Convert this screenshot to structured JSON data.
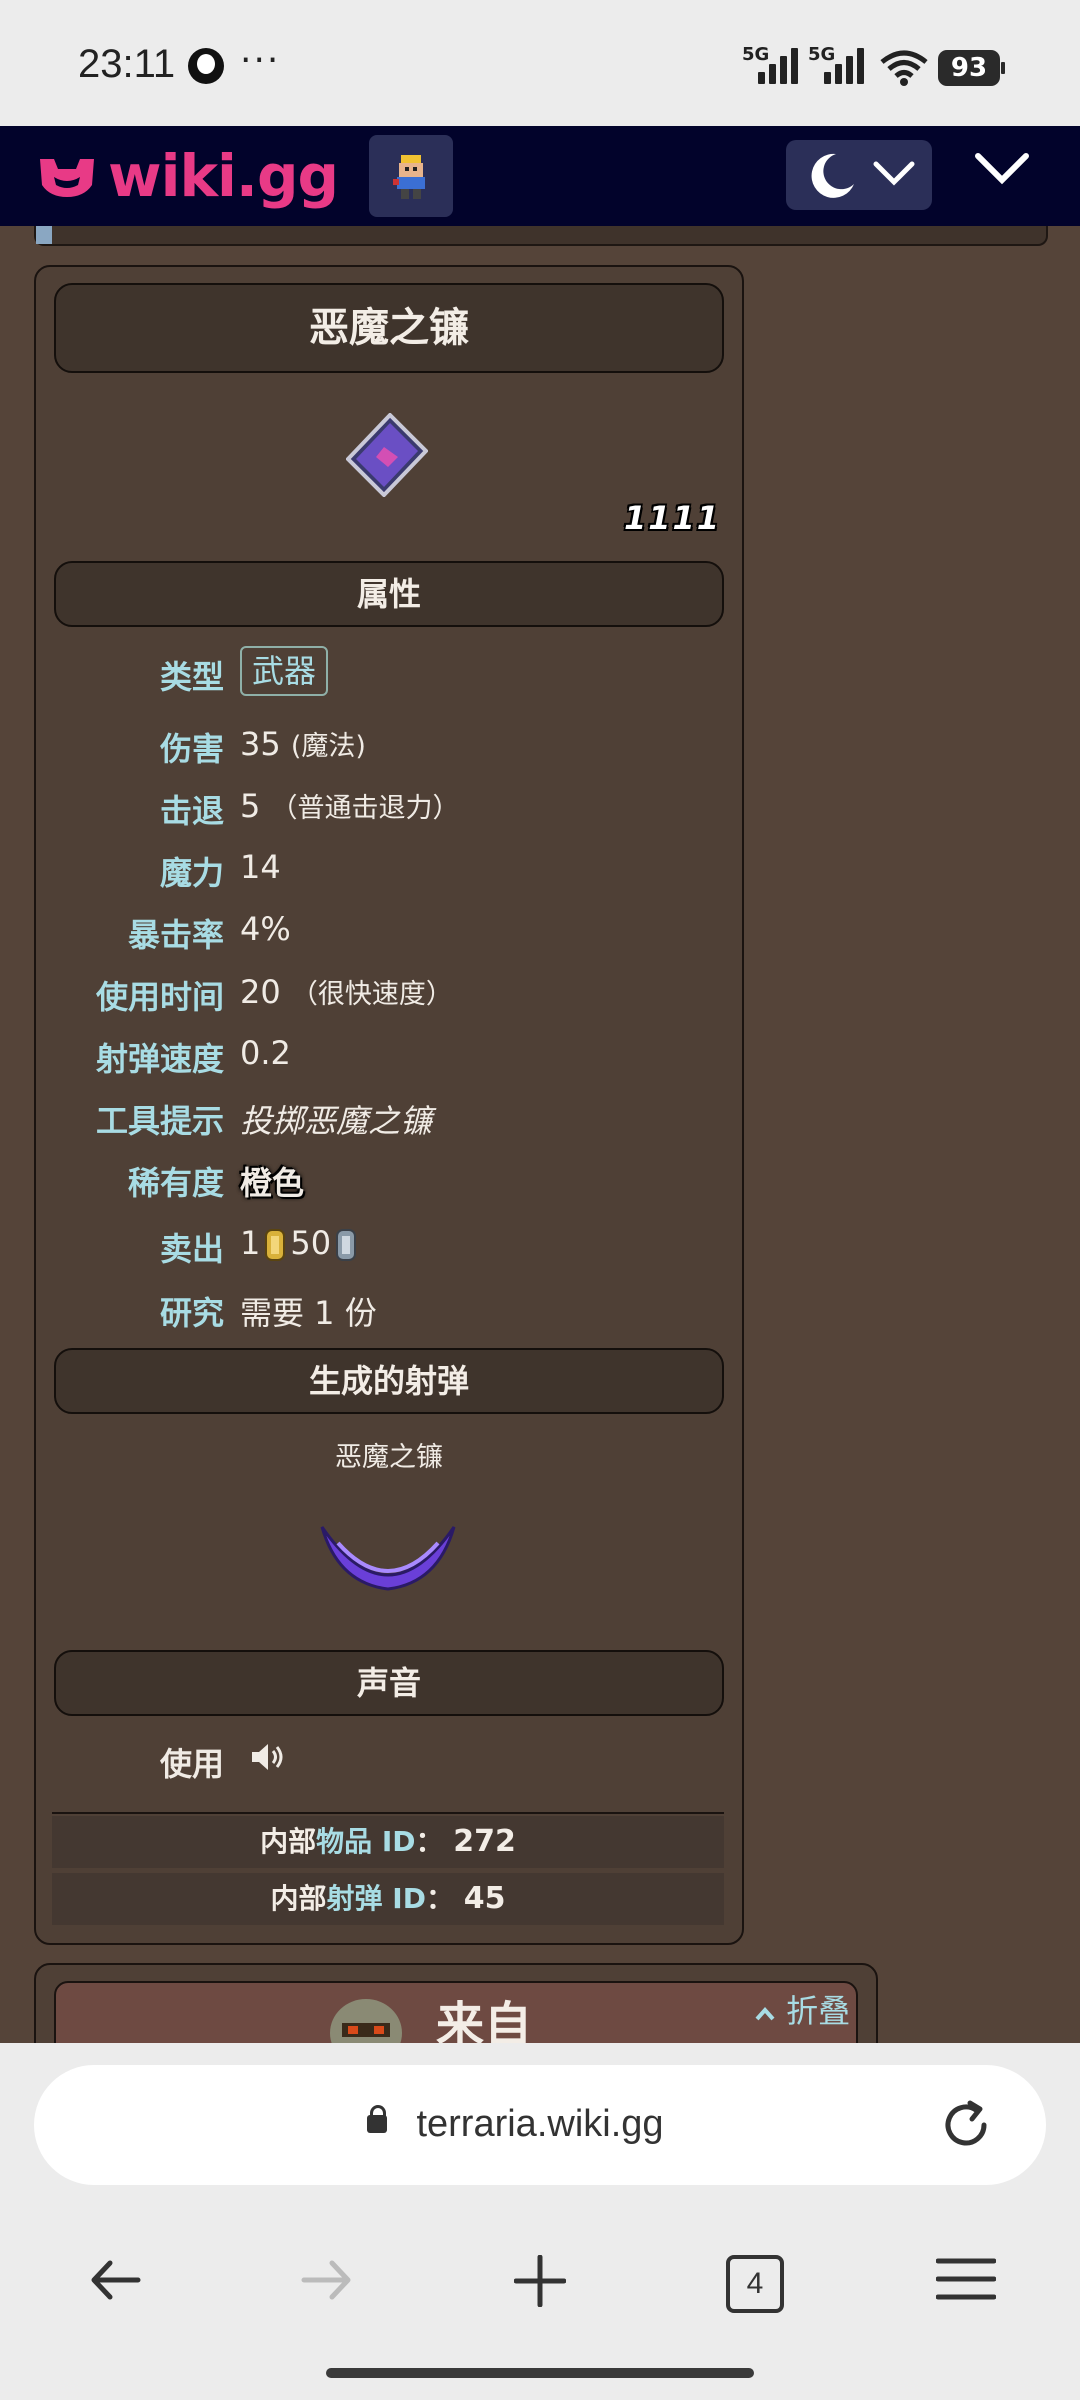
{
  "status_bar": {
    "time": "23:11",
    "more": "···",
    "net1": "5G",
    "net2": "5G",
    "battery": "93"
  },
  "header": {
    "logo_text": "wiki.gg"
  },
  "infobox": {
    "title": "恶魔之镰",
    "stack": "1111",
    "sections": {
      "attributes": "属性",
      "projectile": "生成的射弹",
      "sound": "声音"
    },
    "rows": [
      {
        "label": "类型",
        "value": "武器"
      },
      {
        "label": "伤害",
        "value": "35",
        "extra": "(魔法)"
      },
      {
        "label": "击退",
        "value": "5",
        "extra": "（普通击退力）"
      },
      {
        "label": "魔力",
        "value": "14"
      },
      {
        "label": "暴击率",
        "value": "4%"
      },
      {
        "label": "使用时间",
        "value": "20",
        "extra": "（很快速度）"
      },
      {
        "label": "射弹速度",
        "value": "0.2"
      },
      {
        "label": "工具提示",
        "value": "投掷恶魔之镰"
      },
      {
        "label": "稀有度",
        "value": "橙色"
      },
      {
        "label": "卖出",
        "gold": "1",
        "silver": "50"
      },
      {
        "label": "研究",
        "value": "需要 1 份"
      }
    ],
    "projectile_name": "恶魔之镰",
    "sound_label": "使用",
    "item_id": {
      "prefix": "内部",
      "hl": "物品 ID",
      "colon": "：",
      "value": "272"
    },
    "projectile_id": {
      "prefix": "内部",
      "hl": "射弹 ID",
      "colon": "：",
      "value": "45"
    }
  },
  "from_card": {
    "title": "来自",
    "collapse": "折叠"
  },
  "browser": {
    "url": "terraria.wiki.gg",
    "tab_count": "4"
  }
}
